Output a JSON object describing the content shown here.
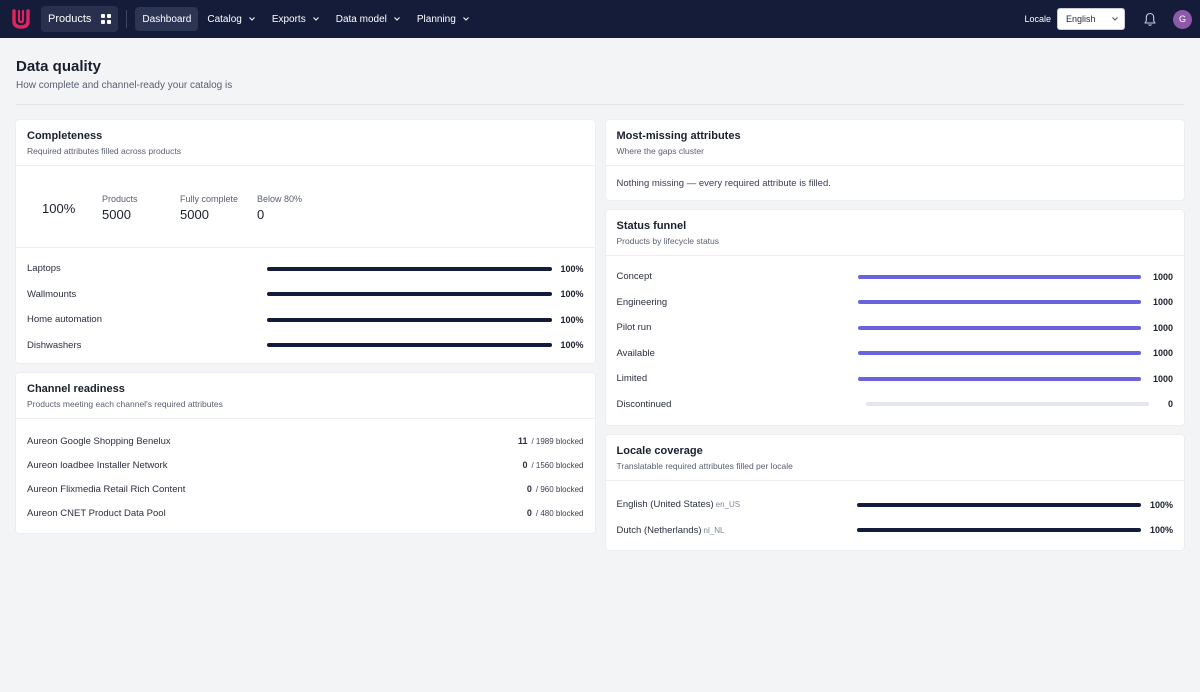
{
  "topbar": {
    "logo_icon": "brand-u-logo",
    "product_switch": "Products",
    "nav": [
      {
        "label": "Dashboard",
        "has_menu": false
      },
      {
        "label": "Catalog",
        "has_menu": true
      },
      {
        "label": "Exports",
        "has_menu": true
      },
      {
        "label": "Data model",
        "has_menu": true
      },
      {
        "label": "Planning",
        "has_menu": true
      }
    ],
    "locale_label": "Locale",
    "locale_value": "English",
    "avatar_initial": "G"
  },
  "page": {
    "title": "Data quality",
    "subtitle": "How complete and channel-ready your catalog is"
  },
  "completeness": {
    "title": "Completeness",
    "subtitle": "Required attributes filled across products",
    "overall": "100%",
    "stats": [
      {
        "label": "Products",
        "value": "5000"
      },
      {
        "label": "Fully complete",
        "value": "5000"
      },
      {
        "label": "Below 80%",
        "value": "0"
      }
    ],
    "rows": [
      {
        "label": "Laptops",
        "value": "100%",
        "fraction": 1.0
      },
      {
        "label": "Wallmounts",
        "value": "100%",
        "fraction": 1.0
      },
      {
        "label": "Home automation",
        "value": "100%",
        "fraction": 1.0
      },
      {
        "label": "Dishwashers",
        "value": "100%",
        "fraction": 1.0
      }
    ]
  },
  "channel_readiness": {
    "title": "Channel readiness",
    "subtitle": "Products meeting each channel's required attributes",
    "rows": [
      {
        "name": "Aureon Google Shopping Benelux",
        "ready": "11",
        "blocked": "/ 1989 blocked"
      },
      {
        "name": "Aureon loadbee Installer Network",
        "ready": "0",
        "blocked": "/ 1560 blocked"
      },
      {
        "name": "Aureon Flixmedia Retail Rich Content",
        "ready": "0",
        "blocked": "/ 960 blocked"
      },
      {
        "name": "Aureon CNET Product Data Pool",
        "ready": "0",
        "blocked": "/ 480 blocked"
      }
    ]
  },
  "most_missing": {
    "title": "Most-missing attributes",
    "subtitle": "Where the gaps cluster",
    "message": "Nothing missing — every required attribute is filled."
  },
  "status_funnel": {
    "title": "Status funnel",
    "subtitle": "Products by lifecycle status",
    "color": "#6b63d9",
    "rows": [
      {
        "label": "Concept",
        "value": "1000",
        "fraction": 1.0
      },
      {
        "label": "Engineering",
        "value": "1000",
        "fraction": 1.0
      },
      {
        "label": "Pilot run",
        "value": "1000",
        "fraction": 1.0
      },
      {
        "label": "Available",
        "value": "1000",
        "fraction": 1.0
      },
      {
        "label": "Limited",
        "value": "1000",
        "fraction": 1.0
      },
      {
        "label": "Discontinued",
        "value": "0",
        "fraction": 0.0
      }
    ]
  },
  "locale_coverage": {
    "title": "Locale coverage",
    "subtitle": "Translatable required attributes filled per locale",
    "rows": [
      {
        "name": "English (United States)",
        "code": "en_US",
        "value": "100%",
        "fraction": 1.0
      },
      {
        "name": "Dutch (Netherlands)",
        "code": "nl_NL",
        "value": "100%",
        "fraction": 1.0
      }
    ]
  }
}
